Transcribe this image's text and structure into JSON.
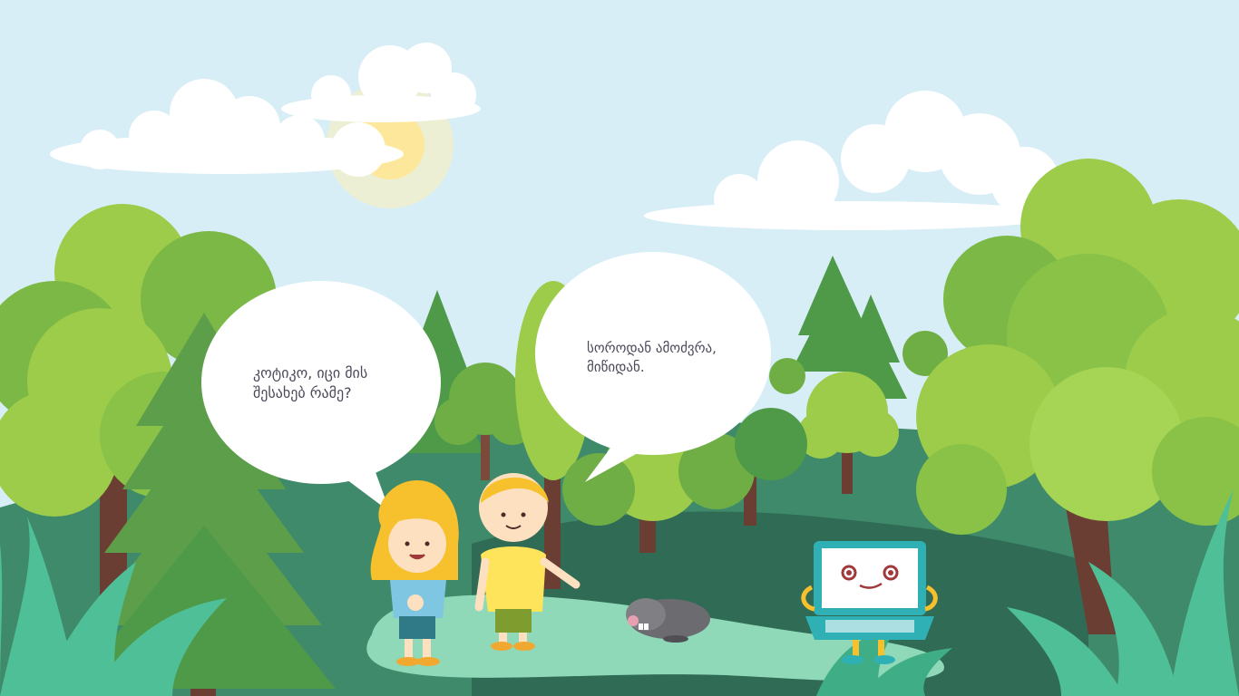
{
  "dialogue": {
    "girl_line": "კოტიკო, იცი მის\nშესახებ რამე?",
    "boy_line": "სოროდან ამოძვრა,\nმიწიდან."
  },
  "colors": {
    "sky": "#d7eef7",
    "cloud": "#ffffff",
    "sun": "#fde79a",
    "tree_light": "#9ccc4a",
    "tree_mid": "#6fae45",
    "tree_dark": "#4f9a48",
    "pine": "#5c9e4a",
    "hill": "#3f8a6a",
    "ground": "#2f6b55",
    "path": "#8fd9b8",
    "grass": "#4fbf97",
    "hair": "#f7c02d",
    "laptop": "#2fb0b5",
    "bubble": "#ffffff"
  }
}
